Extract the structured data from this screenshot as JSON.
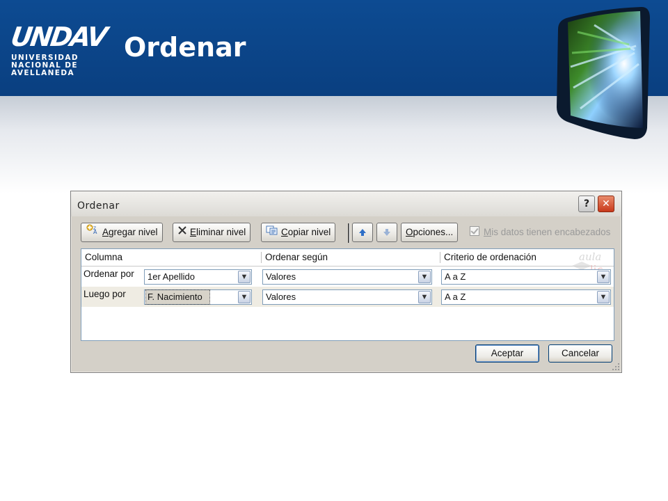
{
  "slide": {
    "title": "Ordenar",
    "logo": {
      "mark": "UNDAV",
      "line1": "UNIVERSIDAD",
      "line2": "NACIONAL DE",
      "line3": "AVELLANEDA"
    },
    "colors": {
      "header_blue": "#0d4b92"
    }
  },
  "dialog": {
    "title": "Ordenar",
    "help_label": "?",
    "close_label": "✕",
    "toolbar": {
      "add_level_pre": "",
      "add_level_hot": "A",
      "add_level_post": "gregar nivel",
      "delete_level_pre": "",
      "delete_level_hot": "E",
      "delete_level_post": "liminar nivel",
      "copy_level_pre": "",
      "copy_level_hot": "C",
      "copy_level_post": "opiar nivel",
      "options_pre": "",
      "options_hot": "O",
      "options_post": "pciones...",
      "headers_checkbox_pre": "",
      "headers_checkbox_hot": "M",
      "headers_checkbox_post": "is datos tienen encabezados"
    },
    "grid": {
      "col_column": "Columna",
      "col_sort_on": "Ordenar según",
      "col_order": "Criterio de ordenación",
      "watermark_1": "aula",
      "watermark_2": "Clic",
      "rows": [
        {
          "label": "Ordenar por",
          "column": "1er Apellido",
          "sort_on": "Valores",
          "order": "A a Z"
        },
        {
          "label": "Luego por",
          "column": "F. Nacimiento",
          "sort_on": "Valores",
          "order": "A a Z"
        }
      ]
    },
    "ok_label": "Aceptar",
    "cancel_label": "Cancelar"
  }
}
